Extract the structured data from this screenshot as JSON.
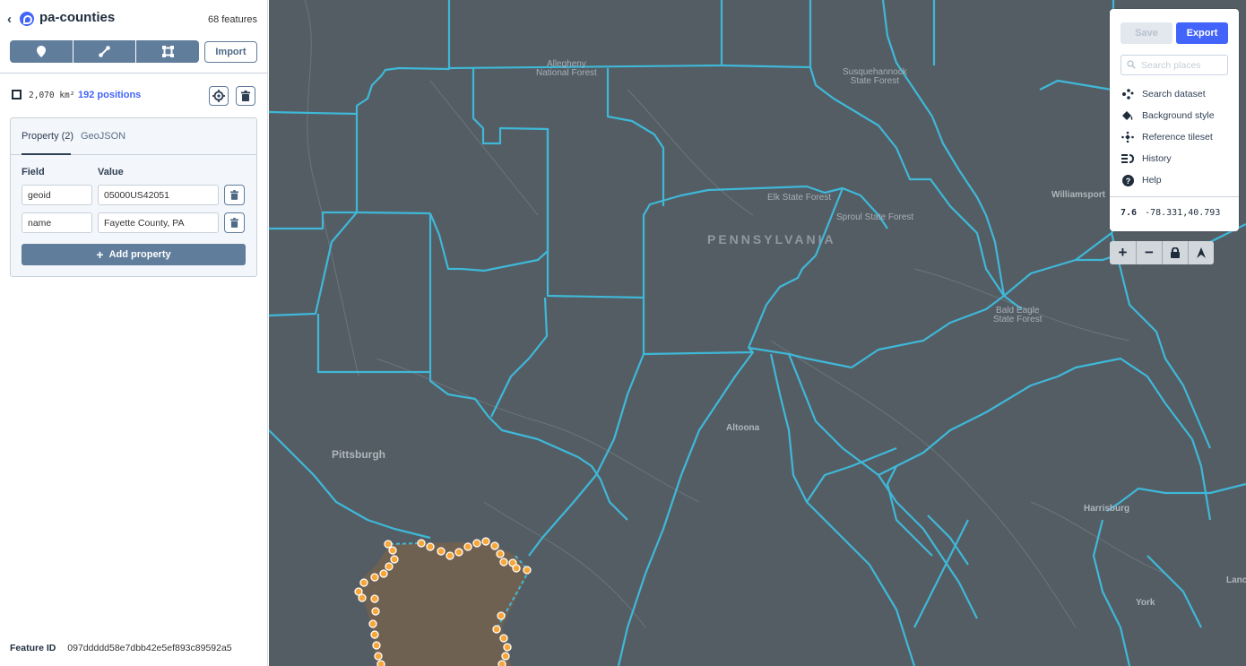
{
  "header": {
    "back_glyph": "‹",
    "title": "pa-counties",
    "feature_count": "68 features",
    "import_label": "Import",
    "draw_tools": [
      {
        "name": "point-tool",
        "icon": "map-marker-icon"
      },
      {
        "name": "line-tool",
        "icon": "line-icon"
      },
      {
        "name": "polygon-tool",
        "icon": "polygon-icon"
      }
    ]
  },
  "feature": {
    "area": "2,070 km²",
    "positions": "192 positions",
    "id_label": "Feature ID",
    "id_value": "097ddddd58e7dbb42e5ef893c89592a5"
  },
  "properties": {
    "tabs": [
      {
        "label": "Property (2)",
        "active": true
      },
      {
        "label": "GeoJSON",
        "active": false
      }
    ],
    "field_header": "Field",
    "value_header": "Value",
    "rows": [
      {
        "field": "geoid",
        "value": "05000US42051"
      },
      {
        "field": "name",
        "value": "Fayette County, PA"
      }
    ],
    "add_label": "Add property"
  },
  "right_panel": {
    "save_label": "Save",
    "export_label": "Export",
    "search_placeholder": "Search places",
    "menu": [
      {
        "label": "Search dataset",
        "icon": "search-dataset-icon"
      },
      {
        "label": "Background style",
        "icon": "paint-bucket-icon"
      },
      {
        "label": "Reference tileset",
        "icon": "tileset-icon"
      },
      {
        "label": "History",
        "icon": "history-icon"
      },
      {
        "label": "Help",
        "icon": "help-icon"
      }
    ],
    "zoom_level": "7.6",
    "coordinates": "-78.331,40.793"
  },
  "map_controls": {
    "zoom_in": "+",
    "zoom_out": "−"
  },
  "map": {
    "state_label": "PENNSYLVANIA",
    "cities": [
      "Pittsburgh",
      "Altoona",
      "Williamsport",
      "Harrisburg",
      "York",
      "Lanc"
    ],
    "forests": [
      "Allegheny\nNational Forest",
      "Susquehannock\nState Forest",
      "Elk State Forest",
      "Sproul State Forest",
      "Bald Eagle\nState Forest"
    ],
    "colors": {
      "background": "#545d64",
      "county_border": "#3fb8d8",
      "selected_vertex": "#f7a638",
      "selected_fill": "#6e6152"
    }
  }
}
